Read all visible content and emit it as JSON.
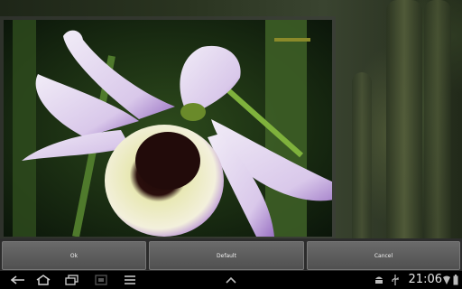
{
  "dialog": {
    "buttons": {
      "ok": "Ok",
      "default": "Default",
      "cancel": "Cancel"
    }
  },
  "status_bar": {
    "time": "21:06",
    "icons": [
      "android-icon",
      "usb-icon",
      "wifi-icon",
      "battery-icon"
    ]
  },
  "nav_bar": {
    "icons": [
      "back-icon",
      "home-icon",
      "recent-apps-icon",
      "screenshot-icon",
      "menu-icon",
      "up-arrow-icon"
    ]
  },
  "colors": {
    "button_bg": "#5e5e5e",
    "navbar_bg": "#000000"
  }
}
